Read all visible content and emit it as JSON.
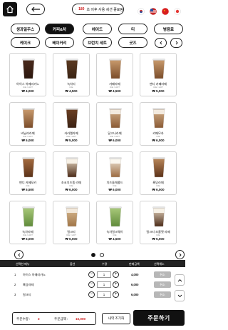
{
  "header": {
    "timer_value": "180",
    "timer_text": "초 이후 사용 세션 종료됨",
    "colors": {
      "accent": "#d01f1f",
      "dark": "#111111"
    }
  },
  "flags": [
    {
      "name": "korea-flag-icon",
      "color": "#c62828"
    },
    {
      "name": "usa-flag-icon",
      "color": "#1e4fa3"
    },
    {
      "name": "china-flag-icon",
      "color": "#d81e1e"
    },
    {
      "name": "japan-flag-icon",
      "color": "#e53935"
    }
  ],
  "categories": {
    "row1": [
      "생과일주스",
      "커피&차",
      "에이드",
      "티",
      "병음료"
    ],
    "row2": [
      "케이크",
      "베이커리",
      "브런치 세트",
      "굿즈"
    ],
    "active": "커피&차"
  },
  "menu_items": [
    {
      "name": "아이스 아메리카노",
      "sub": "ICE / HOT",
      "price": "₩ 4,000",
      "cup": "americano"
    },
    {
      "name": "녹차티",
      "sub": "ICE",
      "price": "₩ 4,500",
      "cup": "green"
    },
    {
      "name": "카페라떼",
      "sub": "ICE / HOT",
      "price": "₩ 4,500",
      "cup": "latte"
    },
    {
      "name": "밴디 카페라떼",
      "sub": "ICE / HOT",
      "price": "₩ 5,000",
      "cup": "latte"
    },
    {
      "name": "바닐라라떼",
      "sub": "ICE / HOT",
      "price": "₩ 5,000",
      "cup": "latte"
    },
    {
      "name": "카라멜라떼",
      "sub": "ICE / HOT",
      "price": "₩ 5,000",
      "cup": "dark"
    },
    {
      "name": "달고나라떼",
      "sub": "ICE / HOT",
      "price": "₩ 6,000",
      "cup": "cream"
    },
    {
      "name": "카페모카",
      "sub": "ICE",
      "price": "₩ 6,000",
      "cup": "cream"
    },
    {
      "name": "밴디 카페모카",
      "sub": "ICE",
      "price": "₩ 5,500",
      "cup": "mocha"
    },
    {
      "name": "초코치즈폼 라떼",
      "sub": "ICE",
      "price": "₩ 6,000",
      "cup": "choco"
    },
    {
      "name": "치즈돌체콜드",
      "sub": "ICE",
      "price": "₩ 6,000",
      "cup": "cheese"
    },
    {
      "name": "흑당라떼",
      "sub": "ICE",
      "price": "₩ 6,000",
      "cup": "brown"
    },
    {
      "name": "녹차라떼",
      "sub": "ICE / HOT",
      "price": "₩ 5,000",
      "cup": "matcha"
    },
    {
      "name": "밀크티",
      "sub": "ICE / HOT",
      "price": "₩ 6,000",
      "cup": "milktea"
    },
    {
      "name": "녹차밀크웨이",
      "sub": "ICE",
      "price": "₩ 4,500",
      "cup": "matcha"
    },
    {
      "name": "밀크티 초콜렛 라떼",
      "sub": "ICE",
      "price": "₩ 5,000",
      "cup": "choco"
    }
  ],
  "table": {
    "headers": [
      "선택한 메뉴",
      "옵션",
      "수량",
      "판매금액",
      "선택해소"
    ]
  },
  "orders": [
    {
      "index": "1",
      "name": "아이스 아메리카노",
      "qty": "1",
      "amount": "4,000",
      "cancel": "취소"
    },
    {
      "index": "2",
      "name": "흑당라떼",
      "qty": "1",
      "amount": "6,000",
      "cancel": "취소"
    },
    {
      "index": "3",
      "name": "밀크티",
      "qty": "1",
      "amount": "6,000",
      "cancel": "취소"
    }
  ],
  "bottom": {
    "qty_label": "주문수량 :",
    "qty_value": "3",
    "total_label": "주문금액 :",
    "total_value": "16,000",
    "history_label": "내역 조기화",
    "order_label": "주문하기"
  }
}
